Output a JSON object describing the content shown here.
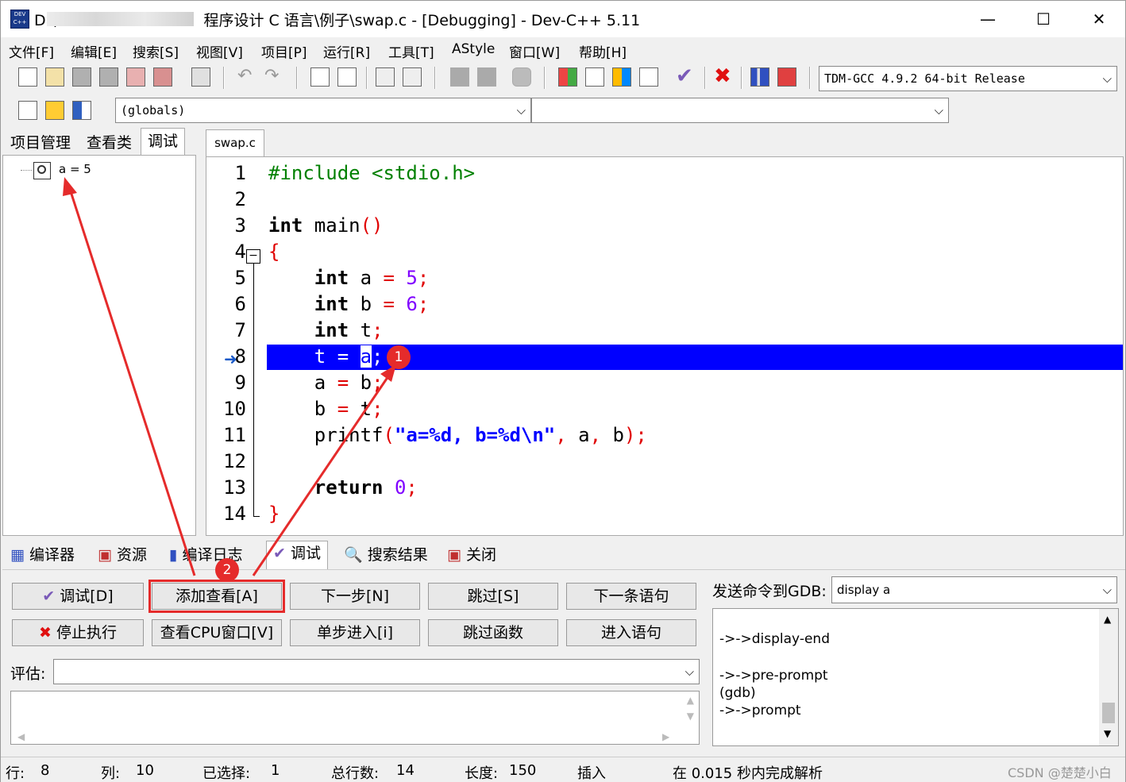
{
  "window": {
    "title_prefix": "D:\\",
    "title_rest": "程序设计 C 语言\\例子\\swap.c - [Debugging] - Dev-C++ 5.11",
    "minimize": "—",
    "maximize": "☐",
    "close": "✕",
    "app_icon_text": "DEV C++"
  },
  "menu": [
    "文件[F]",
    "编辑[E]",
    "搜索[S]",
    "视图[V]",
    "项目[P]",
    "运行[R]",
    "工具[T]",
    "AStyle",
    "窗口[W]",
    "帮助[H]"
  ],
  "toolbar": {
    "compiler_combo": "TDM-GCC 4.9.2 64-bit Release",
    "scope_combo": "(globals)",
    "symbol_combo": ""
  },
  "left_tabs": [
    "项目管理",
    "查看类",
    "调试"
  ],
  "watch_tree": [
    "a = 5"
  ],
  "editor": {
    "tab": "swap.c",
    "current_line": 8
  },
  "bottom_tabs": [
    "编译器",
    "资源",
    "编译日志",
    "调试",
    "搜索结果",
    "关闭"
  ],
  "debug_buttons": {
    "row1": [
      "调试[D]",
      "添加查看[A]",
      "下一步[N]",
      "跳过[S]",
      "下一条语句"
    ],
    "row2": [
      "停止执行",
      "查看CPU窗口[V]",
      "单步进入[i]",
      "跳过函数",
      "进入语句"
    ]
  },
  "evaluate_label": "评估:",
  "evaluate_value": "",
  "gdb": {
    "label": "发送命令到GDB:",
    "command": "display a",
    "output": [
      "->->display-end",
      "",
      "->->pre-prompt",
      "(gdb)",
      "->->prompt"
    ]
  },
  "status": {
    "row_label": "行:",
    "row": "8",
    "col_label": "列:",
    "col": "10",
    "sel_label": "已选择:",
    "sel": "1",
    "total_label": "总行数:",
    "total": "14",
    "len_label": "长度:",
    "len": "150",
    "mode": "插入",
    "parse": "在 0.015 秒内完成解析"
  },
  "badges": [
    "1",
    "2"
  ],
  "watermark": "CSDN @楚楚小白",
  "colors": {
    "highlight": "#0000ff",
    "annotation_red": "#e52b2b"
  }
}
